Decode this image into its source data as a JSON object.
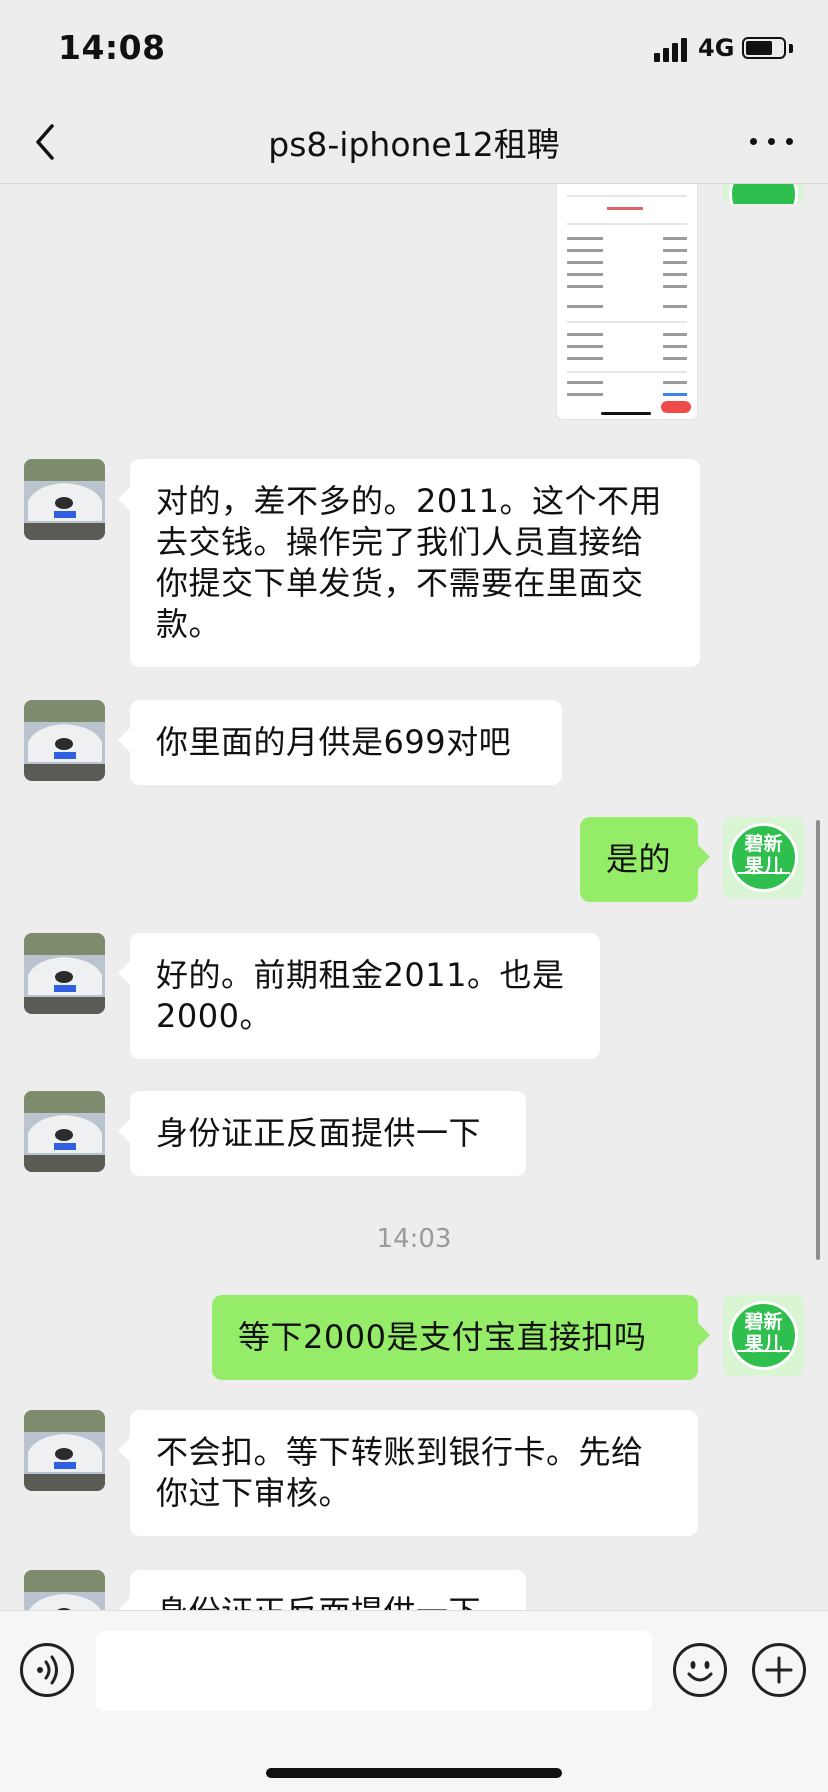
{
  "status_bar": {
    "time": "14:08",
    "network": "4G",
    "battery_level": 0.72
  },
  "nav": {
    "title": "ps8-iphone12租聘"
  },
  "self_avatar": {
    "line1": "碧新",
    "line2": "果儿",
    "color": "#2fbf4f"
  },
  "messages": [
    {
      "text": "对的，差不多的。2011。这个不用去交钱。操作完了我们人员直接给你提交下单发货，不需要在里面交款。"
    },
    {
      "text": "你里面的月供是699对吧"
    },
    {
      "text": "是的"
    },
    {
      "text": "好的。前期租金2011。也是2000。"
    },
    {
      "text": "身份证正反面提供一下"
    },
    {
      "text": "等下2000是支付宝直接扣吗"
    },
    {
      "text": "不会扣。等下转账到银行卡。先给你过下审核。"
    },
    {
      "text": "身份证正反面提供一下"
    }
  ],
  "timestamp": "14:03",
  "input": {
    "value": ""
  },
  "colors": {
    "outgoing_bubble": "#95ec69",
    "incoming_bubble": "#ffffff",
    "background": "#ededed"
  }
}
